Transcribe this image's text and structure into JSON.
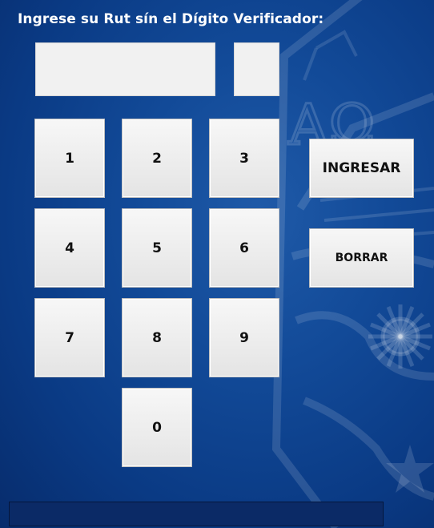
{
  "prompt": {
    "title": "Ingrese su Rut sín el Dígito Verificador:"
  },
  "inputs": {
    "rut": {
      "value": "",
      "placeholder": ""
    },
    "dv": {
      "value": "",
      "placeholder": ""
    }
  },
  "keypad": {
    "k1": "1",
    "k2": "2",
    "k3": "3",
    "k4": "4",
    "k5": "5",
    "k6": "6",
    "k7": "7",
    "k8": "8",
    "k9": "9",
    "k0": "0"
  },
  "actions": {
    "ingresar": "INGRESAR",
    "borrar": "BORRAR"
  },
  "status": {
    "message": ""
  },
  "watermark": {
    "letters": "AΩ"
  },
  "colors": {
    "background": "#124a98",
    "field": "#f1f1f1",
    "button": "#ececec",
    "status_bar": "#0b2a66",
    "title_text": "#ffffff"
  }
}
